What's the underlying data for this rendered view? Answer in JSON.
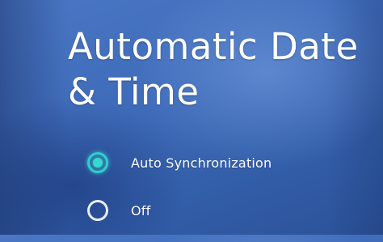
{
  "settings": {
    "title": "Automatic Date & Time",
    "options": [
      {
        "label": "Auto Synchronization",
        "selected": true
      },
      {
        "label": "Off",
        "selected": false
      }
    ]
  },
  "colors": {
    "background": "#3f6cba",
    "accent": "#36d9cf",
    "text": "#ffffff"
  },
  "icons": {
    "selected": "radio-selected-icon",
    "unselected": "radio-unselected-icon"
  }
}
